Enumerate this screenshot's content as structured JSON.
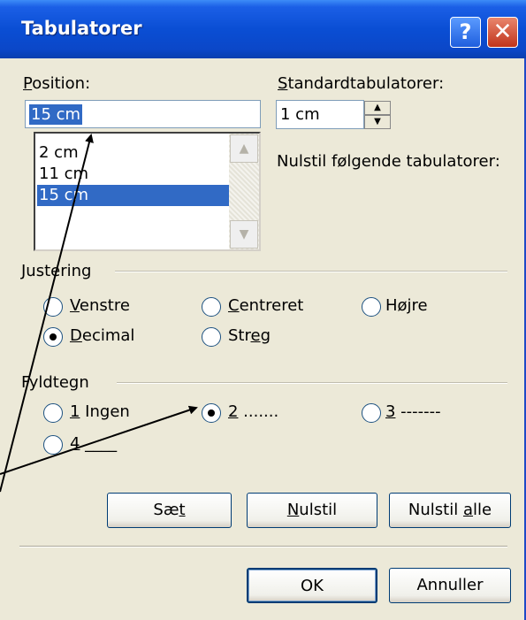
{
  "window": {
    "title": "Tabulatorer",
    "help_label": "?",
    "close_label": "✕"
  },
  "position": {
    "label": "Position:",
    "value": "15 cm",
    "list": [
      "2 cm",
      "11 cm",
      "15 cm"
    ],
    "selected_index": 2
  },
  "standard": {
    "label": "Standardtabulatorer:",
    "value": "1 cm"
  },
  "reset_following_label": "Nulstil følgende tabulatorer:",
  "alignment": {
    "label": "Justering",
    "options": [
      {
        "label": "Venstre",
        "checked": false
      },
      {
        "label": "Centreret",
        "checked": false
      },
      {
        "label": "Højre",
        "checked": false
      },
      {
        "label": "Decimal",
        "checked": true
      },
      {
        "label": "Streg",
        "checked": false
      }
    ]
  },
  "leader": {
    "label": "Fyldtegn",
    "options": [
      {
        "label": "1 Ingen",
        "checked": false
      },
      {
        "label": "2 .......",
        "checked": true
      },
      {
        "label": "3 -------",
        "checked": false
      },
      {
        "label": "4 ____",
        "checked": false
      }
    ]
  },
  "buttons": {
    "set": "Sæt",
    "reset": "Nulstil",
    "reset_all": "Nulstil alle",
    "ok": "OK",
    "cancel": "Annuller"
  },
  "colors": {
    "titlebar": "#0a4ed4",
    "selection": "#316ac5",
    "dialog_bg": "#ece9d8"
  }
}
